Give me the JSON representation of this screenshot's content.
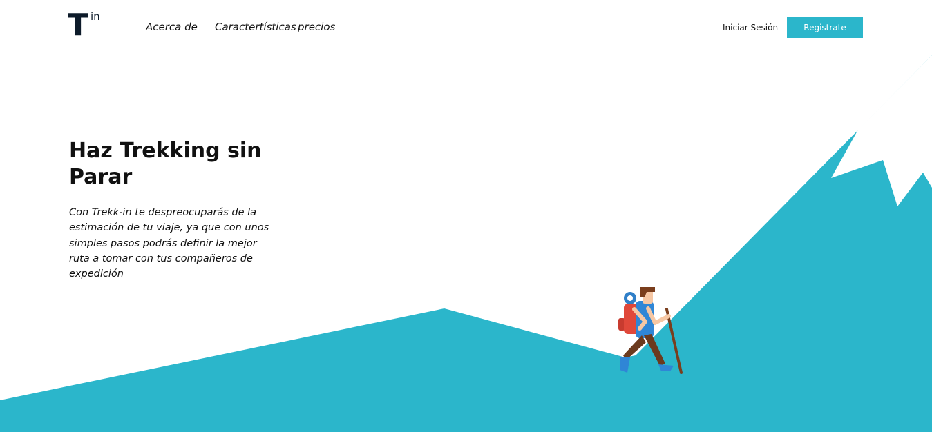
{
  "logo": {
    "letter": "T",
    "suffix": "in"
  },
  "nav": {
    "about": "Acerca de",
    "features": "Caractertísticas",
    "pricing": "precios"
  },
  "auth": {
    "login_label": "Iniciar Sesión",
    "register_label": "Registrate"
  },
  "hero": {
    "title_line1": "Haz Trekking sin",
    "title_line2": "Parar",
    "description": "Con Trekk-in te despreocuparás de la estimación de tu viaje, ya que con unos simples pasos podrás definir la mejor ruta a tomar con tus compañeros de expedición"
  },
  "illustration": {
    "subject": "hiker-climbing-mountain",
    "mountain_color": "#2bb6cb",
    "snow_color": "#ffffff",
    "ground_color": "#f09a86"
  },
  "colors": {
    "accent": "#2bb6cb",
    "text": "#111111",
    "logo": "#0d1b2a"
  }
}
